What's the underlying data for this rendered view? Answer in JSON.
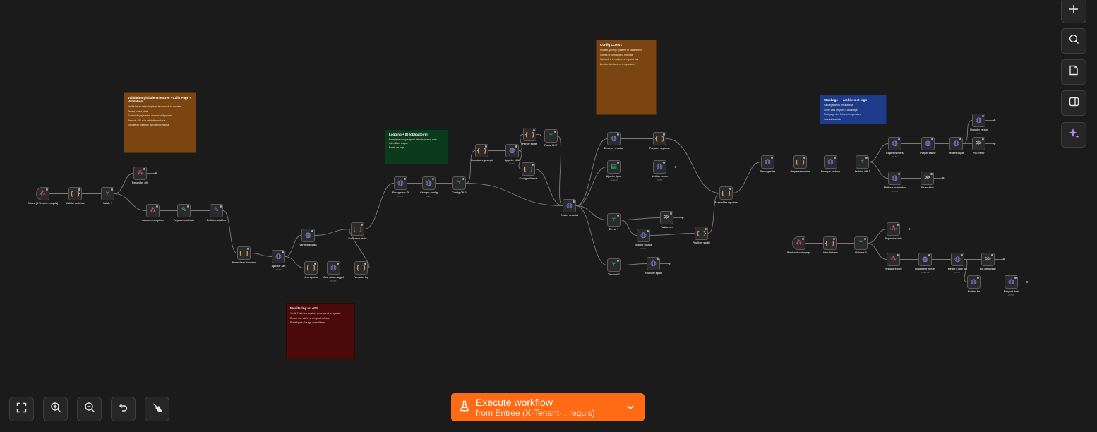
{
  "toolbar": {
    "add_icon": "plus-icon",
    "search_icon": "search-icon",
    "sticky_icon": "sticky-note-icon",
    "panel_icon": "side-panel-icon",
    "ai_icon": "sparkle-icon"
  },
  "zoom_controls": {
    "fit_icon": "fit-view-icon",
    "zoom_in_icon": "zoom-in-icon",
    "zoom_out_icon": "zoom-out-icon",
    "reset_icon": "reset-zoom-icon",
    "clear_icon": "tidy-up-icon"
  },
  "execute": {
    "title": "Execute workflow",
    "subtitle": "from Entree (X-Tenant-...requis)",
    "flask_icon": "flask-icon",
    "dropdown_icon": "chevron-down-icon"
  },
  "colors": {
    "canvas": "#1b1b1b",
    "accent": "#ff6b14",
    "sticky_orange": "#7a4510",
    "sticky_green": "#0b3a1c",
    "sticky_red": "#4a0a0a",
    "sticky_blue": "#1e3a8a"
  },
  "notes": {
    "validation": {
      "title": "Validation globale en entree - Calls Page + Validation",
      "lines": [
        "Verifie les en-tetes requis et le corps de la requete",
        "Tenant, client, date",
        "Format du payload et champs obligatoires",
        "Renvoie 400 si la validation echoue",
        "",
        "Ensuite on continue avec le flux normal"
      ]
    },
    "logging": {
      "title": "Logging + ID (obligatoire)",
      "lines": [
        "Enregistre chaque appel dans le journal avec l'identifiant unique",
        "",
        "Points de logs"
      ]
    },
    "config": {
      "title": "Config LLM v1",
      "lines": [
        "Modele, prompt systeme et parametres",
        "",
        "Sorties et format de la reponse",
        "",
        "Fallback si le modele ne repond pas",
        "",
        "Limites de tokens et temperature"
      ]
    },
    "monitor": {
      "title": "Monitoring (et API)",
      "lines": [
        "Verifie l'etat des services externes et les quotas",
        "",
        "Envoie une alerte si un appel echoue",
        "",
        "Statistiques d'usage consolidees"
      ]
    },
    "storage": {
      "title": "Stockage — archives et logs",
      "lines": [
        "Sauvegarde du resultat final",
        "Copie vers l'espace d'archivage",
        "Nettoyage des fichiers temporaires",
        "Journal d'activite"
      ]
    }
  },
  "nodes": [
    {
      "id": "n1",
      "icon": "webhook-icon",
      "sym": "⁂",
      "cls": "ico-webhook",
      "label": "Entree (X-Tenant-...requis)",
      "trigger": true
    },
    {
      "id": "n2",
      "icon": "code-icon",
      "sym": "{ }",
      "cls": "ico-code",
      "label": "Valider en-tetes"
    },
    {
      "id": "n3",
      "icon": "if-icon",
      "sym": "⑂",
      "cls": "ico-if",
      "label": "Valide ?"
    },
    {
      "id": "n4",
      "icon": "webhook-icon",
      "sym": "⁂",
      "cls": "ico-webhook",
      "label": "Repondre 400"
    },
    {
      "id": "n5",
      "icon": "webhook-icon",
      "sym": "⁂",
      "cls": "ico-webhook",
      "label": "Accuser reception"
    },
    {
      "id": "n6",
      "icon": "wrench-icon",
      "sym": "✎",
      "cls": "ico-wrench",
      "label": "Preparer contexte"
    },
    {
      "id": "n7",
      "icon": "edit-icon",
      "sym": "✎",
      "cls": "ico-set",
      "label": "Definir variables"
    },
    {
      "id": "n8",
      "icon": "code-icon",
      "sym": "{ }",
      "cls": "ico-code",
      "label": "Normaliser donnees"
    },
    {
      "id": "n9",
      "icon": "http-icon",
      "sym": "◍",
      "cls": "ico-http",
      "label": "Appeler API",
      "sub": "POST"
    },
    {
      "id": "n10",
      "icon": "http-icon",
      "sym": "◍",
      "cls": "ico-http",
      "label": "Verifier quotas"
    },
    {
      "id": "n11",
      "icon": "code-icon",
      "sym": "{ }",
      "cls": "ico-code",
      "label": "Lire reponse"
    },
    {
      "id": "n12",
      "icon": "http-icon",
      "sym": "◍",
      "cls": "ico-http",
      "label": "Journaliser appel",
      "sub": "POST"
    },
    {
      "id": "n13",
      "icon": "code-icon",
      "sym": "{ }",
      "cls": "ico-code",
      "label": "Formater log"
    },
    {
      "id": "n14",
      "icon": "code-icon",
      "sym": "{ }",
      "cls": "ico-code",
      "label": "Fusionner etats"
    },
    {
      "id": "n15",
      "icon": "http-icon",
      "sym": "◍",
      "cls": "ico-http",
      "label": "Enregistrer ID",
      "sub": "POST"
    },
    {
      "id": "n16",
      "icon": "http-icon",
      "sym": "◍",
      "cls": "ico-http",
      "label": "Charger config",
      "sub": "GET"
    },
    {
      "id": "n17",
      "icon": "if-icon",
      "sym": "⑂",
      "cls": "ico-if",
      "label": "Config OK ?"
    },
    {
      "id": "n18",
      "icon": "code-icon",
      "sym": "{ }",
      "cls": "ico-code",
      "label": "Construire prompt"
    },
    {
      "id": "n19",
      "icon": "http-icon",
      "sym": "◍",
      "cls": "ico-http",
      "label": "Appeler LLM",
      "sub": "POST"
    },
    {
      "id": "n20",
      "icon": "code-icon",
      "sym": "{ }",
      "cls": "ico-code",
      "label": "Parser sortie"
    },
    {
      "id": "n21",
      "icon": "if-icon",
      "sym": "⑂",
      "cls": "ico-if",
      "label": "Parse OK ?"
    },
    {
      "id": "n22",
      "icon": "code-icon",
      "sym": "{ }",
      "cls": "ico-code",
      "label": "Corriger format"
    },
    {
      "id": "n23",
      "icon": "http-icon",
      "sym": "◍",
      "cls": "ico-http",
      "label": "Router resultat"
    },
    {
      "id": "n24",
      "icon": "http-icon",
      "sym": "◍",
      "cls": "ico-http",
      "label": "Envoyer resultat"
    },
    {
      "id": "n25",
      "icon": "sheet-icon",
      "sym": "▤",
      "cls": "ico-sheet",
      "label": "Ajouter ligne",
      "sub": "append"
    },
    {
      "id": "n26",
      "icon": "if-icon",
      "sym": "⑂",
      "cls": "ico-if",
      "label": "Erreur ?"
    },
    {
      "id": "n27",
      "icon": "if-icon",
      "sym": "⑂",
      "cls": "ico-if",
      "label": "Timeout ?"
    },
    {
      "id": "n28",
      "icon": "code-icon",
      "sym": "{ }",
      "cls": "ico-code",
      "label": "Preparer reponse"
    },
    {
      "id": "n29",
      "icon": "http-icon",
      "sym": "◍",
      "cls": "ico-http",
      "label": "Notifier echec",
      "sub": "POST"
    },
    {
      "id": "n30",
      "icon": "http-icon",
      "sym": "◍",
      "cls": "ico-http",
      "label": "Notifier equipe",
      "sub": "POST"
    },
    {
      "id": "n31",
      "icon": "http-icon",
      "sym": "◍",
      "cls": "ico-http",
      "label": "Relancer appel"
    },
    {
      "id": "n32",
      "icon": "merge-icon",
      "sym": "≫",
      "cls": "ico-merge",
      "label": "Fusionner"
    },
    {
      "id": "n33",
      "icon": "code-icon",
      "sym": "{ }",
      "cls": "ico-code",
      "label": "Finaliser sortie"
    },
    {
      "id": "n34",
      "icon": "code-icon",
      "sym": "{ }",
      "cls": "ico-code",
      "label": "Assembler reponse"
    },
    {
      "id": "n35",
      "icon": "http-icon",
      "sym": "◍",
      "cls": "ico-http",
      "label": "Sauvegarder"
    },
    {
      "id": "n36",
      "icon": "code-icon",
      "sym": "{ }",
      "cls": "ico-code",
      "label": "Preparer archive"
    },
    {
      "id": "n37",
      "icon": "http-icon",
      "sym": "◍",
      "cls": "ico-http",
      "label": "Envoyer archive"
    },
    {
      "id": "n38",
      "icon": "if-icon",
      "sym": "⑂",
      "cls": "ico-if",
      "label": "Archive OK ?"
    },
    {
      "id": "n39",
      "icon": "http-icon",
      "sym": "◍",
      "cls": "ico-http",
      "label": "Copier fichiers",
      "sub": "POST"
    },
    {
      "id": "n40",
      "icon": "http-icon",
      "sym": "◍",
      "cls": "ico-http",
      "label": "Mettre a jour index",
      "sub": "PATCH"
    },
    {
      "id": "n41",
      "icon": "http-icon",
      "sym": "◍",
      "cls": "ico-http",
      "label": "Purger cache"
    },
    {
      "id": "n42",
      "icon": "http-icon",
      "sym": "◍",
      "cls": "ico-http",
      "label": "Verifier copie"
    },
    {
      "id": "n43",
      "icon": "merge-icon",
      "sym": "≫",
      "cls": "ico-merge",
      "label": "Fin archive"
    },
    {
      "id": "n44",
      "icon": "http-icon",
      "sym": "◍",
      "cls": "ico-http",
      "label": "Signaler erreur",
      "sub": "POST"
    },
    {
      "id": "n45",
      "icon": "merge-icon",
      "sym": "≫",
      "cls": "ico-merge",
      "label": "Fin erreur"
    },
    {
      "id": "n46",
      "icon": "webhook-icon",
      "sym": "⁂",
      "cls": "ico-webhook",
      "label": "Webhook nettoyage",
      "trigger": true
    },
    {
      "id": "n47",
      "icon": "code-icon",
      "sym": "{ }",
      "cls": "ico-code",
      "label": "Lister fichiers"
    },
    {
      "id": "n48",
      "icon": "if-icon",
      "sym": "⑂",
      "cls": "ico-if",
      "label": "Fichiers ?"
    },
    {
      "id": "n49",
      "icon": "webhook-icon",
      "sym": "⁂",
      "cls": "ico-webhook",
      "label": "Repondre vide"
    },
    {
      "id": "n50",
      "icon": "webhook-icon",
      "sym": "⁂",
      "cls": "ico-webhook",
      "label": "Repondre liste"
    },
    {
      "id": "n51",
      "icon": "http-icon",
      "sym": "◍",
      "cls": "ico-http",
      "label": "Supprimer fichier",
      "sub": "DELETE"
    },
    {
      "id": "n52",
      "icon": "http-icon",
      "sym": "◍",
      "cls": "ico-http",
      "label": "Mettre a jour log",
      "sub": "POST"
    },
    {
      "id": "n53",
      "icon": "merge-icon",
      "sym": "≫",
      "cls": "ico-merge",
      "label": "Fin nettoyage"
    },
    {
      "id": "n54",
      "icon": "http-icon",
      "sym": "◍",
      "cls": "ico-http",
      "label": "Notifier fin"
    },
    {
      "id": "n55",
      "icon": "http-icon",
      "sym": "◍",
      "cls": "ico-http",
      "label": "Rapport final",
      "sub": "POST"
    }
  ]
}
